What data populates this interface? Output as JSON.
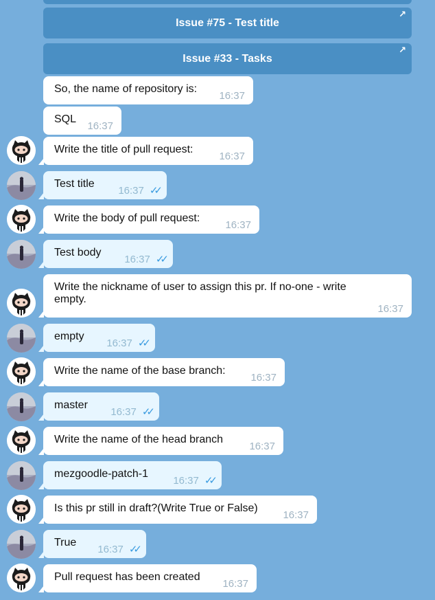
{
  "keyboard": {
    "buttons": [
      {
        "label": "Issue #75 - Test title"
      },
      {
        "label": "Issue #33 - Tasks"
      }
    ]
  },
  "messages": [
    {
      "from": "bot",
      "text": "So, the name of repository is:",
      "time": "16:37"
    },
    {
      "from": "bot",
      "text": "SQL",
      "time": "16:37"
    },
    {
      "from": "bot",
      "text": "Write the title of pull request:",
      "time": "16:37"
    },
    {
      "from": "user",
      "text": "Test title",
      "time": "16:37"
    },
    {
      "from": "bot",
      "text": "Write the body of pull request:",
      "time": "16:37"
    },
    {
      "from": "user",
      "text": "Test body",
      "time": "16:37"
    },
    {
      "from": "bot",
      "text": "Write the nickname of user to assign this pr. If no-one - write\nempty.",
      "time": "16:37"
    },
    {
      "from": "user",
      "text": "empty",
      "time": "16:37"
    },
    {
      "from": "bot",
      "text": "Write the name of the base branch:",
      "time": "16:37"
    },
    {
      "from": "user",
      "text": "master",
      "time": "16:37"
    },
    {
      "from": "bot",
      "text": "Write the name of the head branch",
      "time": "16:37"
    },
    {
      "from": "user",
      "text": "mezgoodle-patch-1",
      "time": "16:37"
    },
    {
      "from": "bot",
      "text": "Is this pr still in draft?(Write True or False)",
      "time": "16:37"
    },
    {
      "from": "user",
      "text": "True",
      "time": "16:37"
    },
    {
      "from": "bot",
      "text": "Pull request has been created",
      "time": "16:37"
    }
  ],
  "icons": {
    "bot_avatar": "github-octocat-icon",
    "user_avatar": "user-photo-avatar",
    "read_receipt": "double-check-icon",
    "open_link": "arrow-up-right-icon"
  },
  "colors": {
    "background": "#76aedc",
    "keyboard_button": "#4a8fc4",
    "bot_bubble": "#ffffff",
    "user_bubble": "#e7f6ff",
    "read_ticks": "#3a9be0"
  }
}
